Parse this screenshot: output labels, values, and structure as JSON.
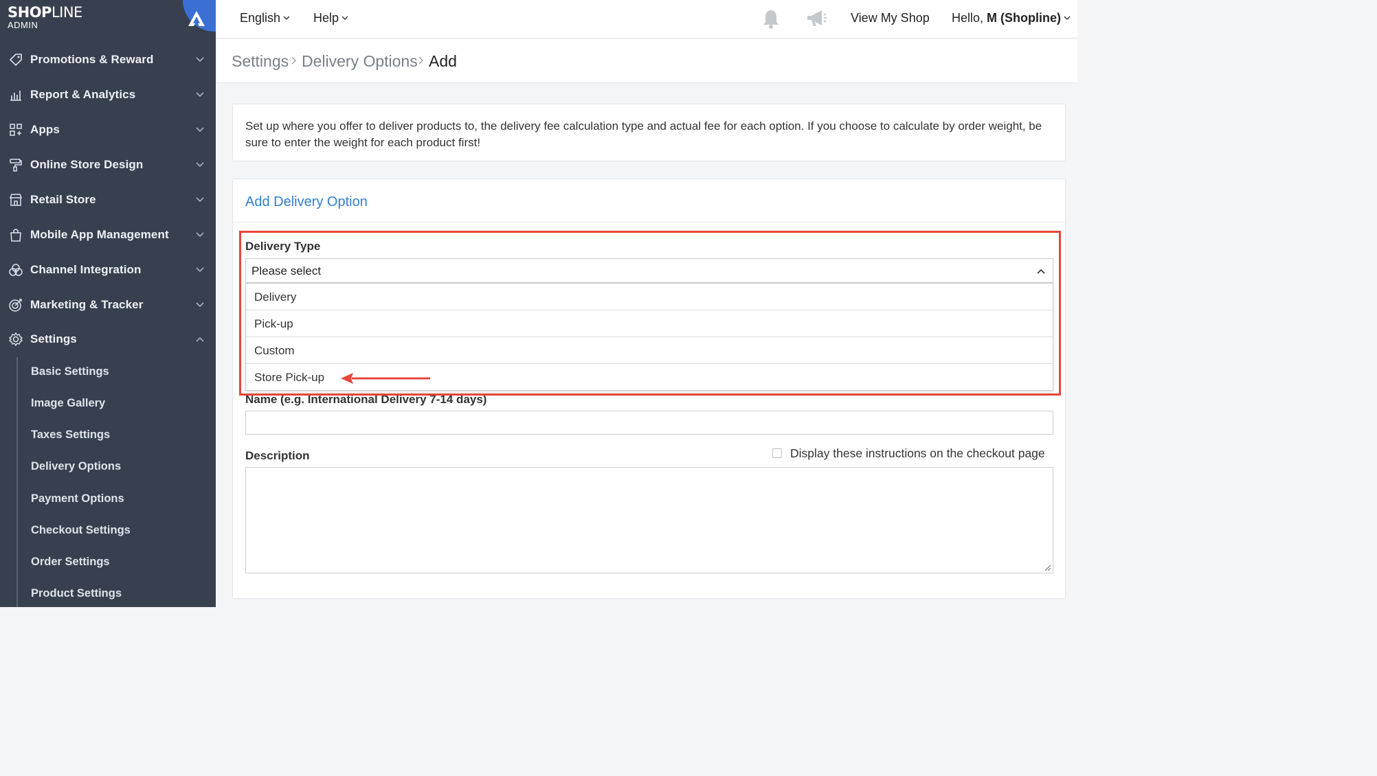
{
  "brand": {
    "logo_bold": "SHOP",
    "logo_light": "LINE",
    "logo_sub": "ADMIN"
  },
  "sidebar": {
    "items": [
      {
        "label": "Promotions & Reward",
        "icon": "tag-icon"
      },
      {
        "label": "Report & Analytics",
        "icon": "chart-icon"
      },
      {
        "label": "Apps",
        "icon": "apps-grid-icon"
      },
      {
        "label": "Online Store Design",
        "icon": "paint-roller-icon"
      },
      {
        "label": "Retail Store",
        "icon": "store-icon"
      },
      {
        "label": "Mobile App Management",
        "icon": "shopping-bag-icon"
      },
      {
        "label": "Channel Integration",
        "icon": "channels-icon"
      },
      {
        "label": "Marketing & Tracker",
        "icon": "target-icon"
      },
      {
        "label": "Settings",
        "icon": "gear-icon"
      }
    ],
    "settings_children": [
      "Basic Settings",
      "Image Gallery",
      "Taxes Settings",
      "Delivery Options",
      "Payment Options",
      "Checkout Settings",
      "Order Settings",
      "Product Settings"
    ]
  },
  "topbar": {
    "language": "English",
    "help": "Help",
    "view_shop": "View My Shop",
    "greeting": "Hello, ",
    "user": "M (Shopline)"
  },
  "breadcrumb": [
    "Settings",
    "Delivery Options",
    "Add"
  ],
  "info": {
    "text": "Set up where you offer to deliver products to, the delivery fee calculation type and actual fee for each option. If you choose to calculate by order weight, be sure to enter the weight for each product first!"
  },
  "form": {
    "title": "Add Delivery Option",
    "delivery_type_label": "Delivery Type",
    "delivery_type_value": "Please select",
    "options": [
      "Delivery",
      "Pick-up",
      "Custom",
      "Store Pick-up"
    ],
    "name_label": "Name (e.g. International Delivery 7-14 days)",
    "name_value": "",
    "description_label": "Description",
    "description_value": "",
    "checkout_checkbox_label": "Display these instructions on the checkout page",
    "checkout_checkbox_checked": false
  },
  "colors": {
    "sidebar_bg": "#38404f",
    "accent_blue": "#2f7fd1",
    "highlight_red": "#e8453c"
  }
}
